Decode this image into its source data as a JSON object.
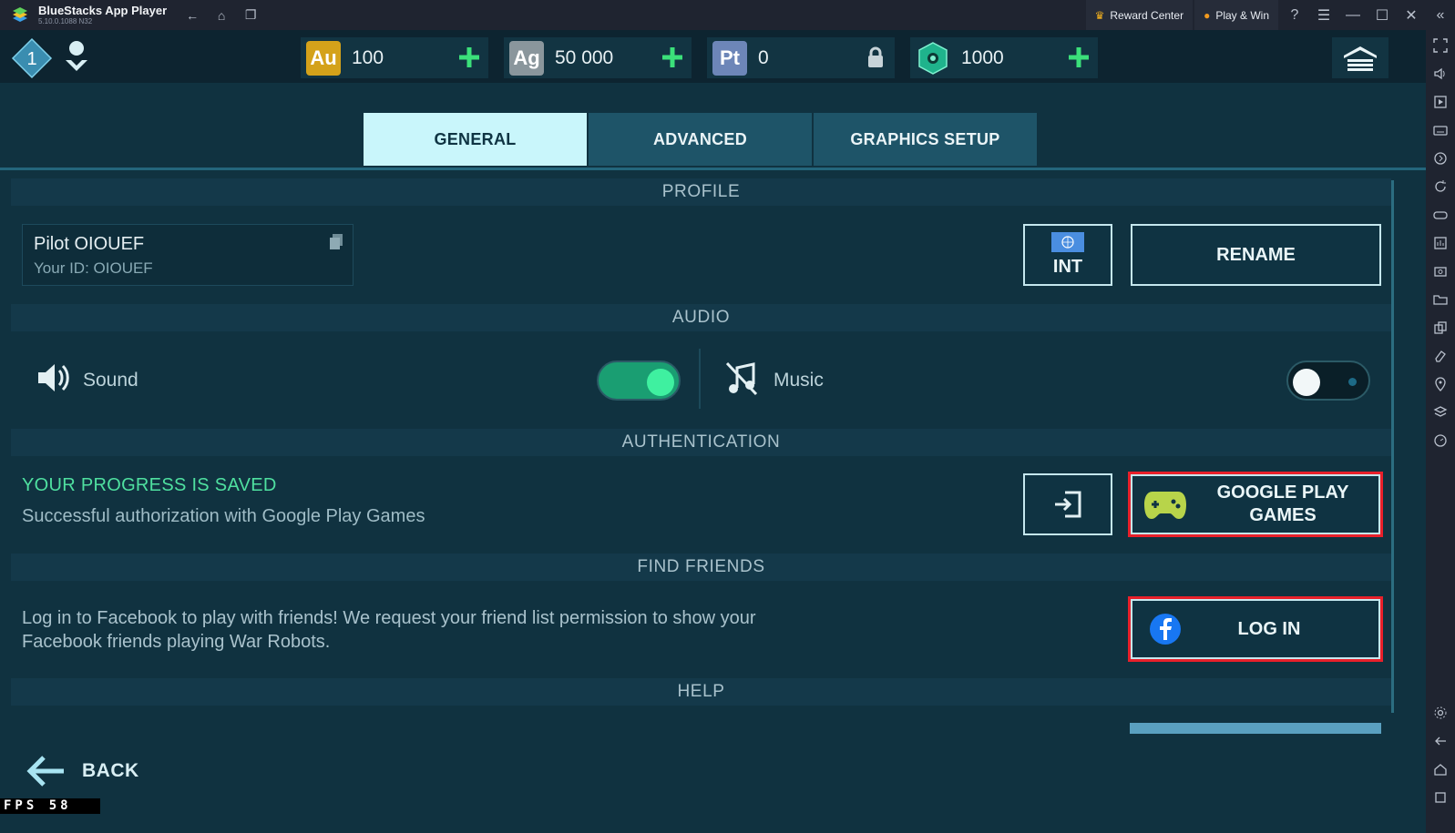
{
  "window": {
    "app_name": "BlueStacks App Player",
    "version": "5.10.0.1088  N32",
    "reward_center": "Reward Center",
    "play_win": "Play & Win"
  },
  "topbar": {
    "level": "1",
    "currencies": [
      {
        "code": "Au",
        "value": "100",
        "color": "#d4a21a",
        "action": "plus"
      },
      {
        "code": "Ag",
        "value": "50 000",
        "color": "#8a969c",
        "action": "plus"
      },
      {
        "code": "Pt",
        "value": "0",
        "color": "#6d86b8",
        "action": "lock"
      },
      {
        "code": "",
        "value": "1000",
        "color": "#1fb38c",
        "action": "plus"
      }
    ]
  },
  "tabs": [
    {
      "label": "GENERAL",
      "active": true
    },
    {
      "label": "ADVANCED",
      "active": false
    },
    {
      "label": "GRAPHICS SETUP",
      "active": false
    }
  ],
  "sections": {
    "profile": "PROFILE",
    "audio": "AUDIO",
    "authentication": "AUTHENTICATION",
    "find_friends": "FIND FRIENDS",
    "help": "HELP"
  },
  "profile": {
    "pilot_name": "Pilot OIOUEF",
    "your_id": "Your ID: OIOUEF",
    "region_button": "INT",
    "rename_button": "RENAME"
  },
  "audio": {
    "sound_label": "Sound",
    "sound_on": true,
    "music_label": "Music",
    "music_on": false
  },
  "auth": {
    "status_title": "YOUR PROGRESS IS SAVED",
    "status_text": "Successful authorization with Google Play Games",
    "google_button_line1": "GOOGLE PLAY",
    "google_button_line2": "GAMES"
  },
  "friends": {
    "text": "Log in to Facebook to play with friends! We request your friend list permission to show your Facebook friends playing War Robots.",
    "login_button": "LOG IN"
  },
  "footer": {
    "back_label": "BACK",
    "fps": "FPS  58"
  },
  "colors": {
    "accent": "#c9f6fb",
    "toggle_on": "#1a9e72",
    "highlight": "#e8202a",
    "saved_green": "#4fe0a0"
  }
}
